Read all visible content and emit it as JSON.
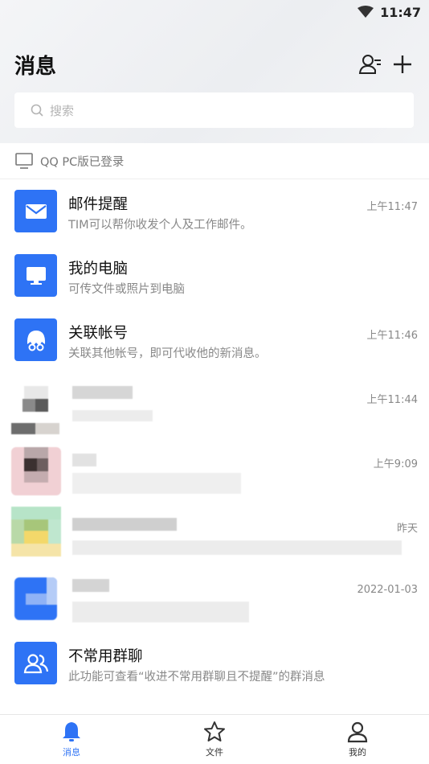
{
  "status_bar": {
    "time": "11:47",
    "icons": [
      "wifi-icon"
    ]
  },
  "header": {
    "title": "消息",
    "icons": [
      "add-contact-icon",
      "plus-icon"
    ]
  },
  "search": {
    "placeholder": "搜索",
    "icon": "search-icon"
  },
  "pc_login": {
    "text": "QQ PC版已登录",
    "icon": "monitor-icon"
  },
  "conversations": [
    {
      "name": "邮件提醒",
      "preview": "TIM可以帮你收发个人及工作邮件。",
      "time": "上午11:47",
      "icon": "mail-icon",
      "color": "#2e73f5"
    },
    {
      "name": "我的电脑",
      "preview": "可传文件或照片到电脑",
      "time": "",
      "icon": "computer-icon",
      "color": "#2e73f5"
    },
    {
      "name": "关联帐号",
      "preview": "关联其他帐号，即可代收他的新消息。",
      "time": "上午11:46",
      "icon": "linked-account-icon",
      "color": "#2e73f5"
    },
    {
      "name": "",
      "preview": "",
      "time": "上午11:44",
      "icon": "blurred-avatar"
    },
    {
      "name": "",
      "preview": "",
      "time": "上午9:09",
      "icon": "blurred-avatar"
    },
    {
      "name": "",
      "preview": "",
      "time": "昨天",
      "icon": "blurred-avatar"
    },
    {
      "name": "",
      "preview": "",
      "time": "2022-01-03",
      "icon": "blurred-avatar"
    },
    {
      "name": "不常用群聊",
      "preview": "此功能可查看“收进不常用群聊且不提醒”的群消息",
      "time": "",
      "icon": "group-icon",
      "color": "#2e73f5"
    }
  ],
  "tabs": [
    {
      "label": "消息",
      "icon": "bell-icon",
      "active": true
    },
    {
      "label": "文件",
      "icon": "star-icon",
      "active": false
    },
    {
      "label": "我的",
      "icon": "person-icon",
      "active": false
    }
  ],
  "colors": {
    "accent": "#2e73f5",
    "text": "#111111",
    "muted": "#888888"
  }
}
